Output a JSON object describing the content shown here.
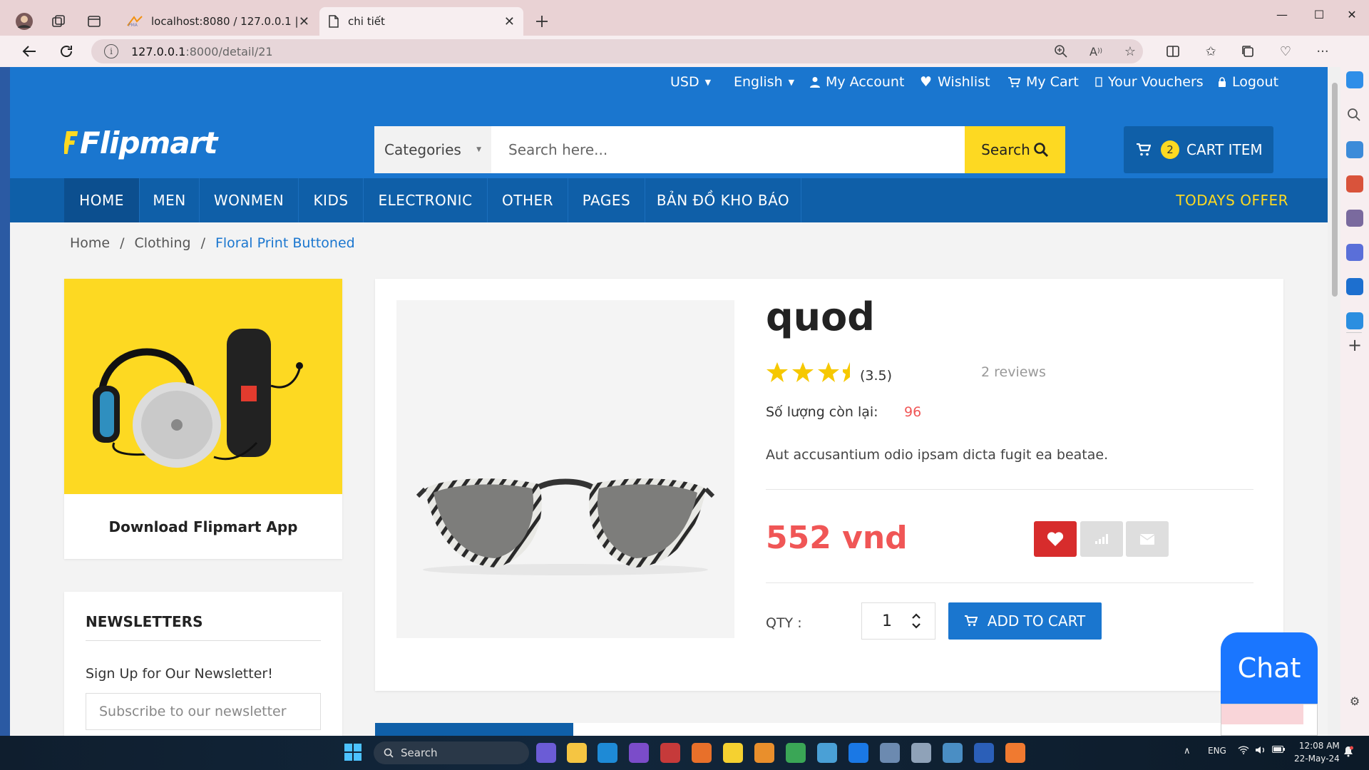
{
  "browser": {
    "tabs": [
      {
        "title": "localhost:8080 / 127.0.0.1 | phpMyAdmin",
        "active": false
      },
      {
        "title": "chi tiết",
        "active": true
      }
    ],
    "url_host": "127.0.0.1",
    "url_path": ":8000/detail/21"
  },
  "topbar": {
    "currency": "USD",
    "language": "English",
    "my_account": "My Account",
    "wishlist": "Wishlist",
    "my_cart": "My Cart",
    "vouchers": "Your Vouchers",
    "logout": "Logout"
  },
  "header": {
    "logo": "Flipmart",
    "categories": "Categories",
    "search_placeholder": "Search here...",
    "search_button": "Search",
    "cart_count": "2",
    "cart_label": "CART ITEM"
  },
  "nav": {
    "items": [
      "HOME",
      "MEN",
      "WONMEN",
      "KIDS",
      "ELECTRONIC",
      "OTHER",
      "PAGES",
      "BẢN ĐỒ KHO BÁO"
    ],
    "offer": "TODAYS OFFER"
  },
  "breadcrumb": [
    "Home",
    "Clothing",
    "Floral Print Buttoned"
  ],
  "sidebar": {
    "app_label": "Download Flipmart App",
    "newsletter_title": "NEWSLETTERS",
    "newsletter_sub": "Sign Up for Our Newsletter!",
    "newsletter_placeholder": "Subscribe to our newsletter"
  },
  "product": {
    "title": "quod",
    "rating": 3.5,
    "rating_text": "(3.5)",
    "reviews": "2 reviews",
    "stock_label": "Số lượng còn lại:",
    "stock_value": "96",
    "description": "Aut accusantium odio ipsam dicta fugit ea beatae.",
    "price": "552 vnd",
    "qty_label": "QTY :",
    "qty_value": "1",
    "add_to_cart": "ADD TO CART"
  },
  "chat": {
    "label": "Chat"
  },
  "taskbar": {
    "search": "Search",
    "lang": "ENG",
    "time": "12:08 AM",
    "date": "22-May-24"
  },
  "colors": {
    "brand_blue": "#1a76cf",
    "nav_blue": "#0f5fa8",
    "accent_yellow": "#fdd922",
    "price_red": "#f05656"
  }
}
